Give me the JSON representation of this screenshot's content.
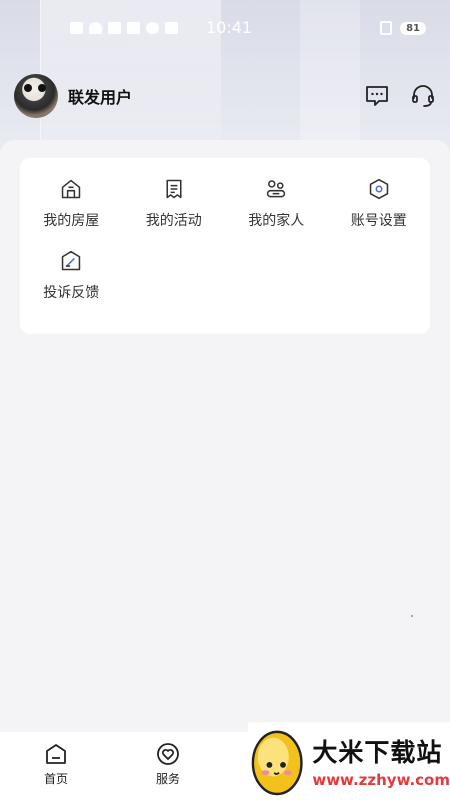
{
  "status_bar": {
    "time": "10:41",
    "battery": "81"
  },
  "header": {
    "username": "联发用户",
    "actions": [
      {
        "name": "message-icon"
      },
      {
        "name": "headset-icon"
      }
    ]
  },
  "menu": {
    "items": [
      {
        "label": "我的房屋",
        "icon": "house-icon"
      },
      {
        "label": "我的活动",
        "icon": "receipt-icon"
      },
      {
        "label": "我的家人",
        "icon": "family-icon"
      },
      {
        "label": "账号设置",
        "icon": "settings-hex-icon"
      },
      {
        "label": "投诉反馈",
        "icon": "feedback-edit-icon"
      }
    ]
  },
  "bottom_nav": {
    "items": [
      {
        "label": "首页",
        "icon": "home-icon"
      },
      {
        "label": "服务",
        "icon": "heart-service-icon"
      }
    ]
  },
  "watermark": {
    "title": "大米下载站",
    "url": "www.zzhyw.com"
  },
  "colors": {
    "background": "#f4f4f6",
    "card": "#ffffff",
    "icon_stroke": "#333333",
    "watermark_url": "#e23b3b"
  }
}
